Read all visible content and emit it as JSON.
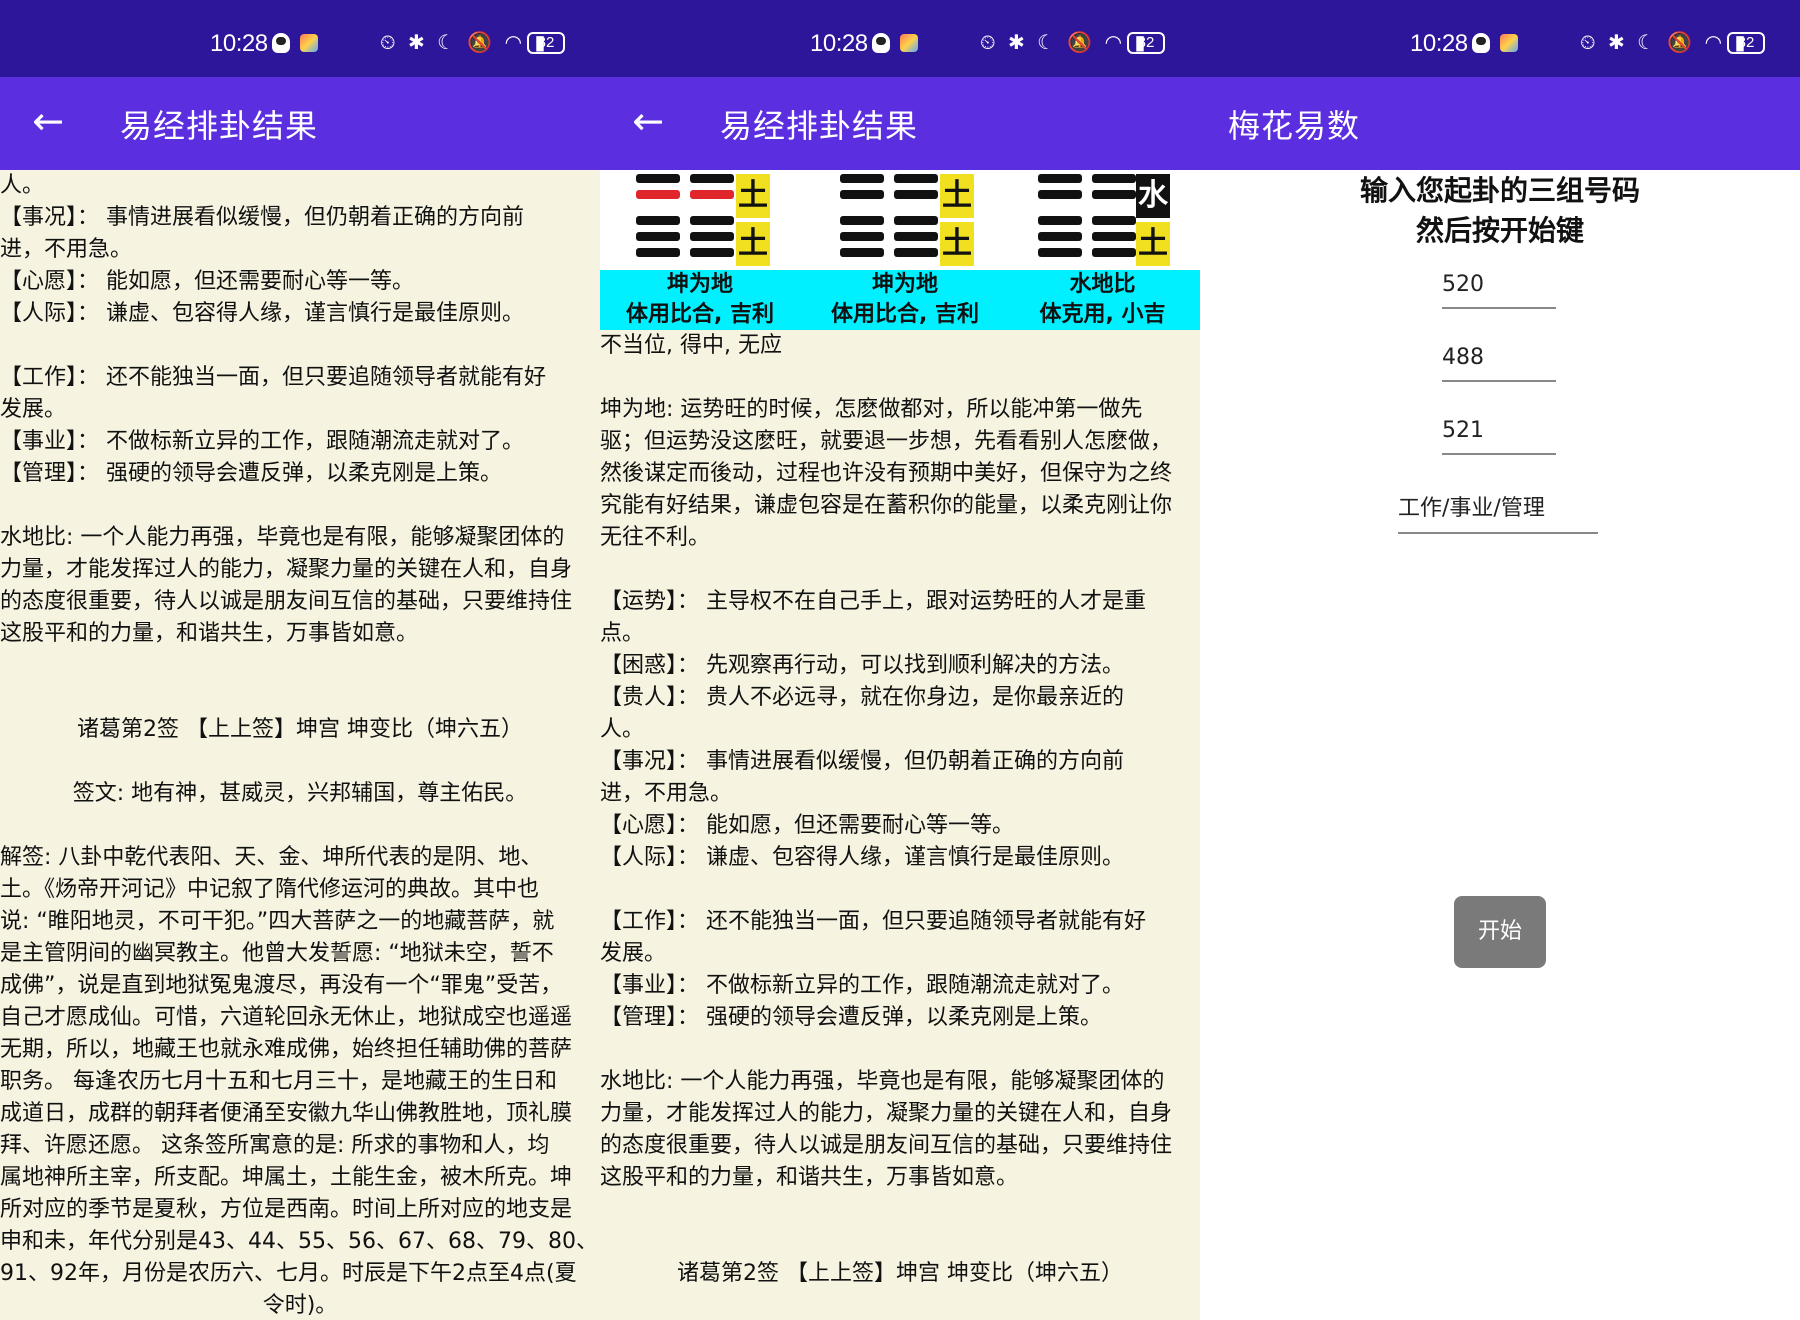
{
  "status": {
    "time": "10:28",
    "icons": "⏲ ✱ ☾ 🔕 ◠ ▮",
    "battery": "32"
  },
  "panel1": {
    "title": "易经排卦结果",
    "lines": [
      "人。",
      "【事况】：  事情进展看似缓慢，但仍朝着正确的方向前",
      "进，不用急。",
      "【心愿】：  能如愿，但还需要耐心等一等。",
      "【人际】：  谦虚、包容得人缘，谨言慎行是最佳原则。",
      "",
      "【工作】：  还不能独当一面，但只要追随领导者就能有好",
      "发展。",
      "【事业】：  不做标新立异的工作，跟随潮流走就对了。",
      "【管理】：  强硬的领导会遭反弹，以柔克刚是上策。",
      "",
      "水地比: 一个人能力再强，毕竟也是有限，能够凝聚团体的",
      "力量，才能发挥过人的能力，凝聚力量的关键在人和，自身",
      "的态度很重要，待人以诚是朋友间互信的基础，只要维持住",
      "这股平和的力量，和谐共生，万事皆如意。",
      "",
      "",
      "诸葛第2签 【上上签】坤宫 坤变比（坤六五）",
      "",
      "签文:  地有神，甚威灵，兴邦辅国，尊主佑民。",
      "",
      "解签: 八卦中乾代表阳、天、金、坤所代表的是阴、地、",
      "土。《炀帝开河记》中记叙了隋代修运河的典故。其中也",
      "说: “睢阳地灵，不可干犯。”四大菩萨之一的地藏菩萨，就",
      "是主管阴间的幽冥教主。他曾大发誓愿: “地狱未空，誓不",
      "成佛”，说是直到地狱冤鬼渡尽，再没有一个“罪鬼”受苦，",
      "自己才愿成仙。可惜，六道轮回永无休止，地狱成空也遥遥",
      "无期，所以，地藏王也就永难成佛，始终担任辅助佛的菩萨",
      "职务。 每逢农历七月十五和七月三十，是地藏王的生日和",
      "成道日，成群的朝拜者便涌至安徽九华山佛教胜地，顶礼膜",
      "拜、许愿还愿。 这条签所寓意的是: 所求的事物和人，均",
      "属地神所主宰，所支配。坤属土，土能生金，被木所克。坤",
      "所对应的季节是夏秋，方位是西南。时间上所对应的地支是",
      "申和未，年代分别是43、44、55、56、67、68、79、80、",
      "91、92年，月份是农历六、七月。时辰是下午2点至4点(夏",
      "令时)。"
    ]
  },
  "panel2": {
    "title": "易经排卦结果",
    "hexagrams": [
      {
        "upper": "土",
        "lower": "土",
        "name": "坤为地",
        "relation": "体用比合, 吉利"
      },
      {
        "upper": "土",
        "lower": "土",
        "name": "坤为地",
        "relation": "体用比合, 吉利"
      },
      {
        "upper": "水",
        "lower": "土",
        "name": "水地比",
        "relation": "体克用, 小吉"
      }
    ],
    "lines": [
      "不当位, 得中, 无应",
      "",
      "坤为地: 运势旺的时候，怎麽做都对，所以能冲第一做先",
      "驱；但运势没这麽旺，就要退一步想，先看看别人怎麽做，",
      "然後谋定而後动，过程也许没有预期中美好，但保守为之终",
      "究能有好结果，谦虚包容是在蓄积你的能量，以柔克刚让你",
      "无往不利。",
      "",
      "【运势】：  主导权不在自己手上，跟对运势旺的人才是重",
      "点。",
      "【困惑】：  先观察再行动，可以找到顺利解决的方法。",
      "【贵人】：  贵人不必远寻，就在你身边，是你最亲近的",
      "人。",
      "【事况】：  事情进展看似缓慢，但仍朝着正确的方向前",
      "进，不用急。",
      "【心愿】：  能如愿，但还需要耐心等一等。",
      "【人际】：  谦虚、包容得人缘，谨言慎行是最佳原则。",
      "",
      "【工作】：  还不能独当一面，但只要追随领导者就能有好",
      "发展。",
      "【事业】：  不做标新立异的工作，跟随潮流走就对了。",
      "【管理】：  强硬的领导会遭反弹，以柔克刚是上策。",
      "",
      "水地比: 一个人能力再强，毕竟也是有限，能够凝聚团体的",
      "力量，才能发挥过人的能力，凝聚力量的关键在人和，自身",
      "的态度很重要，待人以诚是朋友间互信的基础，只要维持住",
      "这股平和的力量，和谐共生，万事皆如意。",
      "",
      "",
      "诸葛第2签 【上上签】坤宫 坤变比（坤六五）"
    ]
  },
  "panel3": {
    "title": "梅花易数",
    "prompt_line1": "输入您起卦的三组号码",
    "prompt_line2": "然后按开始键",
    "num1": "520",
    "num2": "488",
    "num3": "521",
    "category": "工作/事业/管理",
    "start_label": "开始"
  }
}
